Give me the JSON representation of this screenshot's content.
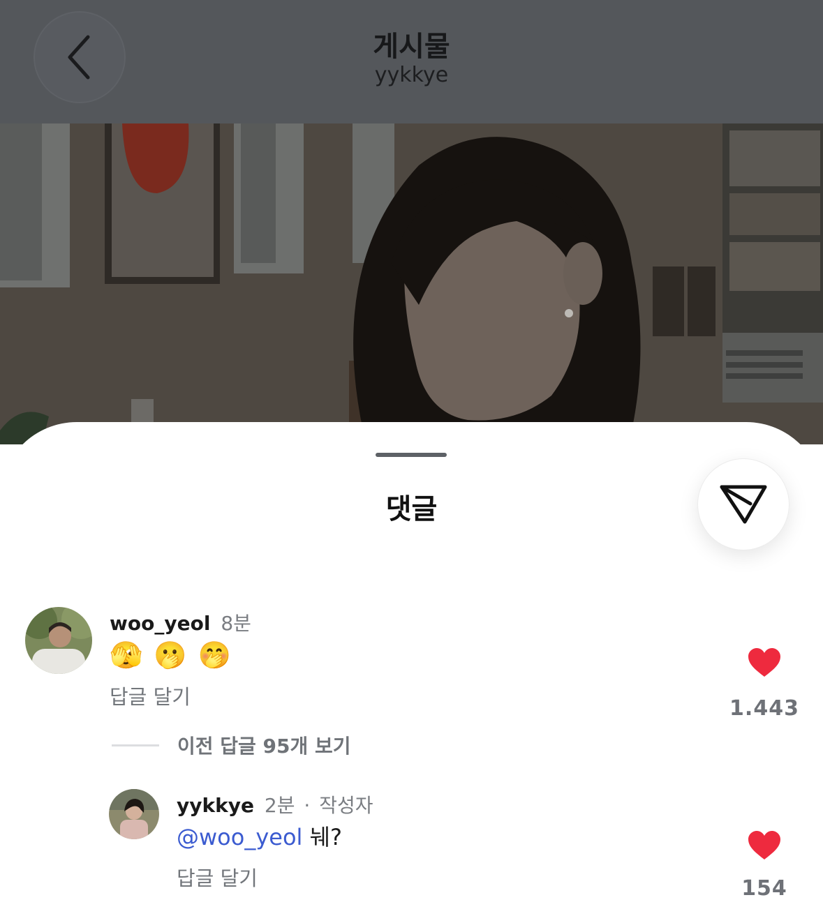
{
  "header": {
    "title": "게시물",
    "subtitle": "yykkye"
  },
  "sheet": {
    "title": "댓글"
  },
  "comments": [
    {
      "username": "woo_yeol",
      "time": "8분",
      "text": "🫣 🫢 🤭",
      "reply_label": "답글 달기",
      "likes": "1.443"
    }
  ],
  "view_replies_label": "이전 답글 95개 보기",
  "reply": {
    "username": "yykkye",
    "time": "2분",
    "separator": "·",
    "author_tag": "작성자",
    "mention": "@woo_yeol",
    "text": "눼?",
    "reply_label": "답글 달기",
    "likes": "154"
  },
  "colors": {
    "like": "#ee2a3e",
    "mention": "#3b5bd0",
    "overlay": "#54575b"
  }
}
